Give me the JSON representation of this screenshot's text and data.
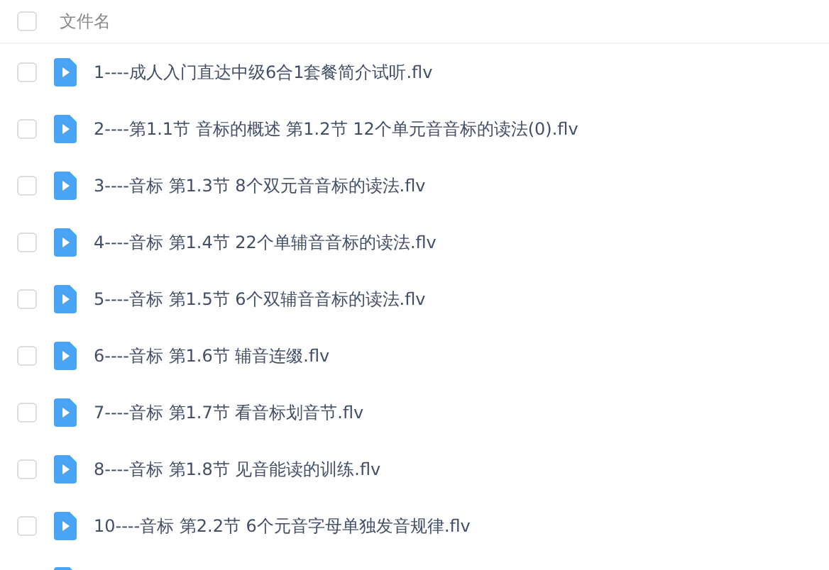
{
  "header": {
    "checked": false,
    "label": "文件名"
  },
  "files": [
    {
      "name": "1----成人入门直达中级6合1套餐简介试听.flv",
      "checked": false
    },
    {
      "name": "2----第1.1节 音标的概述 第1.2节 12个单元音音标的读法(0).flv",
      "checked": false
    },
    {
      "name": "3----音标 第1.3节 8个双元音音标的读法.flv",
      "checked": false
    },
    {
      "name": "4----音标 第1.4节 22个单辅音音标的读法.flv",
      "checked": false
    },
    {
      "name": "5----音标 第1.5节 6个双辅音音标的读法.flv",
      "checked": false
    },
    {
      "name": "6----音标 第1.6节 辅音连缀.flv",
      "checked": false
    },
    {
      "name": "7----音标 第1.7节 看音标划音节.flv",
      "checked": false
    },
    {
      "name": "8----音标 第1.8节 见音能读的训练.flv",
      "checked": false
    },
    {
      "name": "10----音标 第2.2节 6个元音字母单独发音规律.flv",
      "checked": false
    }
  ]
}
